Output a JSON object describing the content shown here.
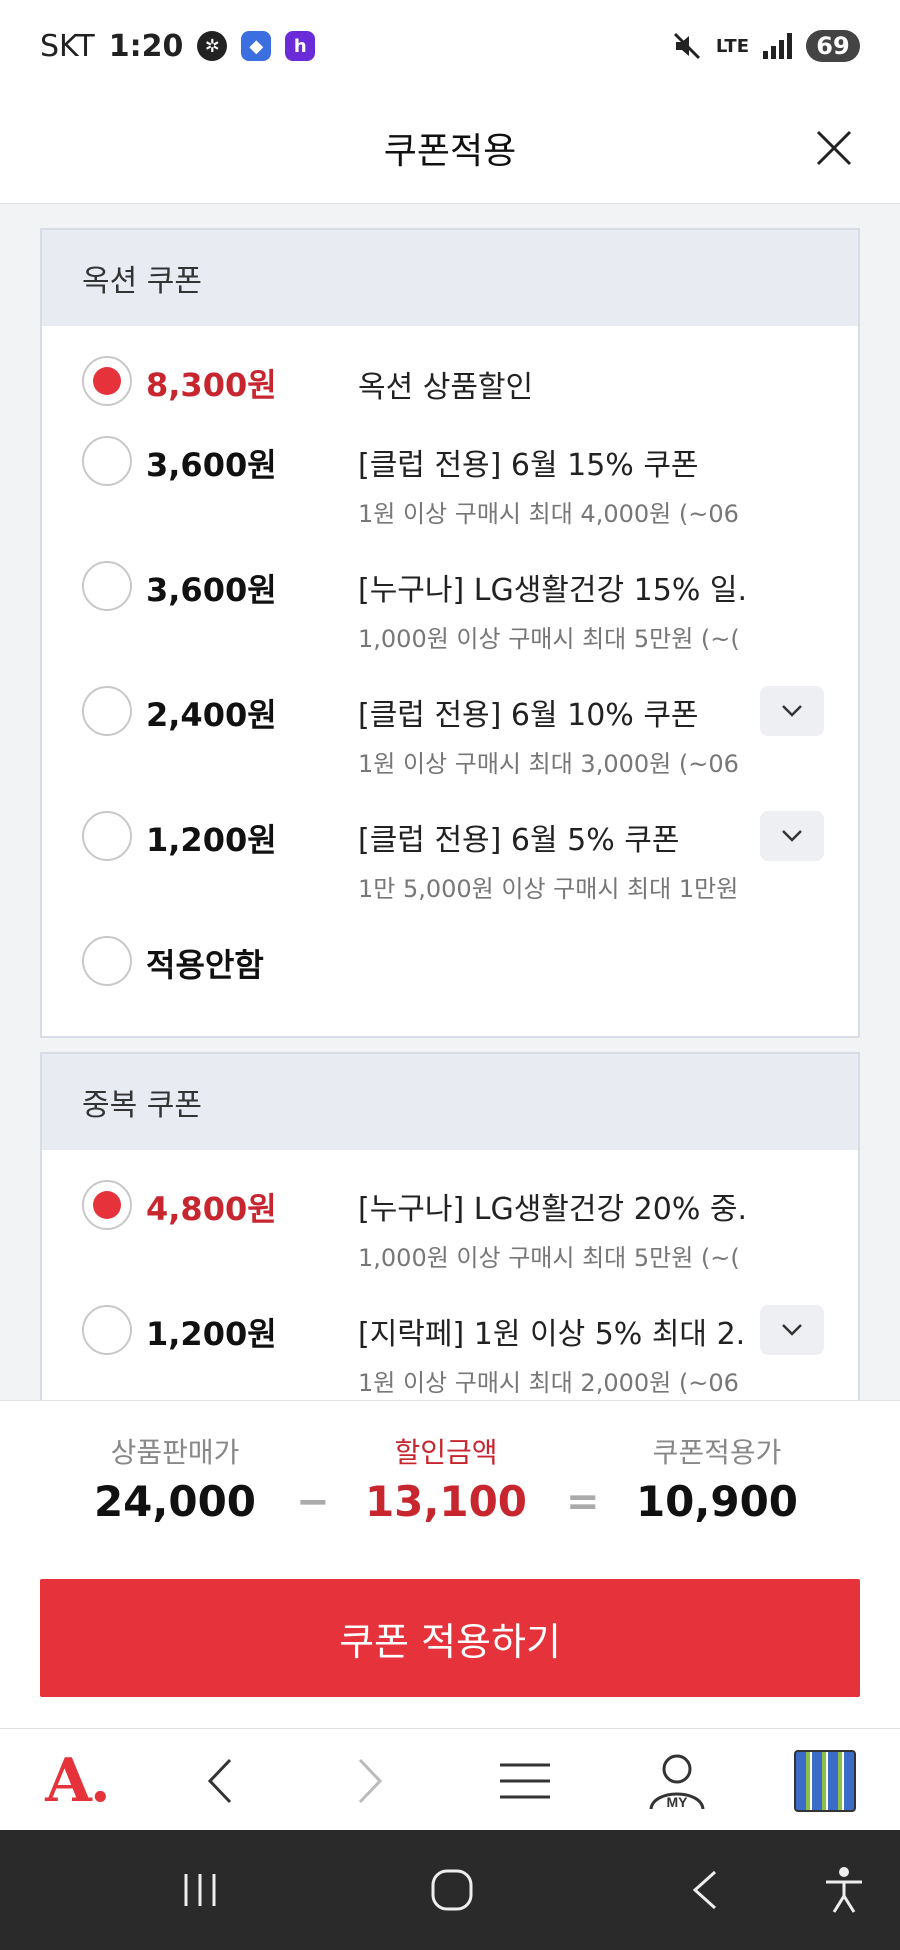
{
  "status_bar": {
    "carrier": "SKT",
    "time": "1:20",
    "network": "LTE",
    "battery": "69"
  },
  "header": {
    "title": "쿠폰적용"
  },
  "option_section": {
    "title": "옥션 쿠폰",
    "coupons": [
      {
        "amount": "8,300원",
        "title": "옥션 상품할인",
        "desc": "",
        "selected": true
      },
      {
        "amount": "3,600원",
        "title": "[클럽 전용] 6월 15% 쿠폰",
        "desc": "1원 이상 구매시 최대 4,000원 (~06",
        "selected": false
      },
      {
        "amount": "3,600원",
        "title": "[누구나] LG생활건강 15% 일...",
        "desc": "1,000원 이상 구매시 최대 5만원 (~(",
        "selected": false
      },
      {
        "amount": "2,400원",
        "title": "[클럽 전용] 6월 10% 쿠폰",
        "desc": "1원 이상 구매시 최대 3,000원 (~06",
        "selected": false
      },
      {
        "amount": "1,200원",
        "title": "[클럽 전용] 6월 5% 쿠폰",
        "desc": "1만 5,000원 이상 구매시 최대 1만원",
        "selected": false
      },
      {
        "amount": "적용안함",
        "title": "",
        "desc": "",
        "selected": false
      }
    ]
  },
  "dup_section": {
    "title": "중복 쿠폰",
    "coupons": [
      {
        "amount": "4,800원",
        "title": "[누구나] LG생활건강 20% 중...",
        "desc": "1,000원 이상 구매시 최대 5만원 (~(",
        "selected": true
      },
      {
        "amount": "1,200원",
        "title": "[지락페] 1원 이상 5% 최대 2...",
        "desc": "1원 이상 구매시 최대 2,000원 (~06",
        "selected": false
      }
    ]
  },
  "summary": {
    "price_label": "상품판매가",
    "price_value": "24,000",
    "minus": "−",
    "discount_label": "할인금액",
    "discount_value": "13,100",
    "equals": "=",
    "final_label": "쿠폰적용가",
    "final_value": "10,900"
  },
  "apply_button": {
    "label": "쿠폰 적용하기"
  },
  "bottom_nav": {
    "logo": "A.",
    "my_label": "MY"
  },
  "colors": {
    "accent": "#e5323b",
    "accent_text": "#c8262f",
    "section_header_bg": "#e8ebf1"
  }
}
